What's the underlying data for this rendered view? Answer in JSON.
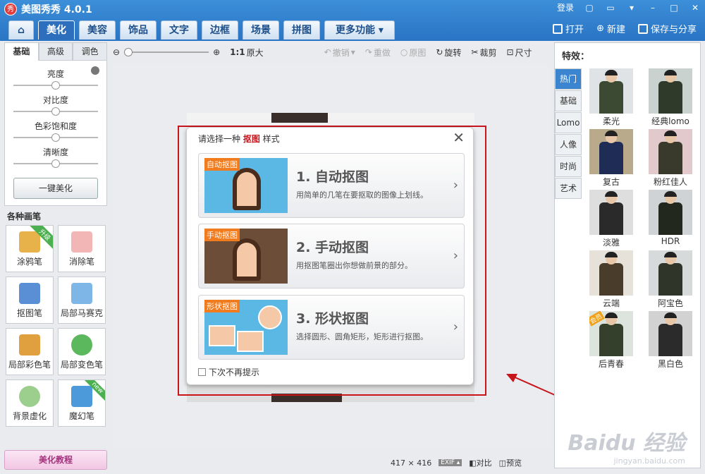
{
  "app": {
    "title": "美图秀秀 4.0.1",
    "logo_text": "秀"
  },
  "titlebar_right": {
    "login": "登录"
  },
  "tabs": [
    {
      "label": ""
    },
    {
      "label": "美化"
    },
    {
      "label": "美容"
    },
    {
      "label": "饰品"
    },
    {
      "label": "文字"
    },
    {
      "label": "边框"
    },
    {
      "label": "场景"
    },
    {
      "label": "拼图"
    },
    {
      "label": "更多功能 ▾"
    }
  ],
  "actions": {
    "open": "打开",
    "new": "新建",
    "save_share": "保存与分享"
  },
  "left": {
    "subtabs": [
      "基础",
      "高级",
      "调色"
    ],
    "adjust": [
      "亮度",
      "对比度",
      "色彩饱和度",
      "清晰度"
    ],
    "onekey": "一键美化",
    "brush_title": "各种画笔",
    "brushes": [
      {
        "label": "涂鸦笔",
        "badge": "升级"
      },
      {
        "label": "消除笔",
        "badge": ""
      },
      {
        "label": "抠图笔",
        "badge": ""
      },
      {
        "label": "局部马赛克",
        "badge": ""
      },
      {
        "label": "局部彩色笔",
        "badge": ""
      },
      {
        "label": "局部变色笔",
        "badge": ""
      },
      {
        "label": "背景虚化",
        "badge": ""
      },
      {
        "label": "魔幻笔",
        "badge": "new"
      }
    ],
    "tutorial": "美化教程"
  },
  "toolbar": {
    "ratio": "1:1",
    "original_size": "原大",
    "undo": "撤销",
    "redo": "重做",
    "original": "原图",
    "rotate": "旋转",
    "crop": "裁剪",
    "size": "尺寸"
  },
  "dialog": {
    "title_pre": "请选择一种 ",
    "title_em": "抠图",
    "title_post": " 样式",
    "options": [
      {
        "tag": "自动抠图",
        "title": "1. 自动抠图",
        "desc": "用简单的几笔在要抠取的图像上划线。"
      },
      {
        "tag": "手动抠图",
        "title": "2. 手动抠图",
        "desc": "用抠图笔圈出你想做前景的部分。"
      },
      {
        "tag": "形状抠图",
        "title": "3. 形状抠图",
        "desc": "选择圆形、圆角矩形，矩形进行抠图。"
      }
    ],
    "no_more": "下次不再提示"
  },
  "right": {
    "title": "特效：",
    "categories": [
      "热门",
      "基础",
      "Lomo",
      "人像",
      "时尚",
      "艺术"
    ],
    "effects": [
      {
        "label": "柔光",
        "coat": "#3d4a33",
        "bg": "#dfe3e6",
        "badge": ""
      },
      {
        "label": "经典lomo",
        "coat": "#2f3a2a",
        "bg": "#c9d2cf",
        "badge": ""
      },
      {
        "label": "复古",
        "coat": "#1f2c55",
        "bg": "#b8aa8a",
        "badge": ""
      },
      {
        "label": "粉红佳人",
        "coat": "#3a3a2c",
        "bg": "#e2c9cc",
        "badge": ""
      },
      {
        "label": "淡雅",
        "coat": "#2a2a2a",
        "bg": "#dedede",
        "badge": ""
      },
      {
        "label": "HDR",
        "coat": "#22281e",
        "bg": "#cfd3d6",
        "badge": ""
      },
      {
        "label": "云端",
        "coat": "#4a3c2a",
        "bg": "#e6e1d9",
        "badge": ""
      },
      {
        "label": "阿宝色",
        "coat": "#2f3629",
        "bg": "#d6dadb",
        "badge": ""
      },
      {
        "label": "后青春",
        "coat": "#34402c",
        "bg": "#dde4dd",
        "badge": "会员"
      },
      {
        "label": "黑白色",
        "coat": "#2b2b2b",
        "bg": "#d2d2d2",
        "badge": ""
      }
    ]
  },
  "status": {
    "size": "417 × 416",
    "exif": "EXIF ▴",
    "compare": "对比",
    "preview": "预览"
  },
  "watermark": {
    "text": "Baidu 经验",
    "sub": "jingyan.baidu.com"
  }
}
